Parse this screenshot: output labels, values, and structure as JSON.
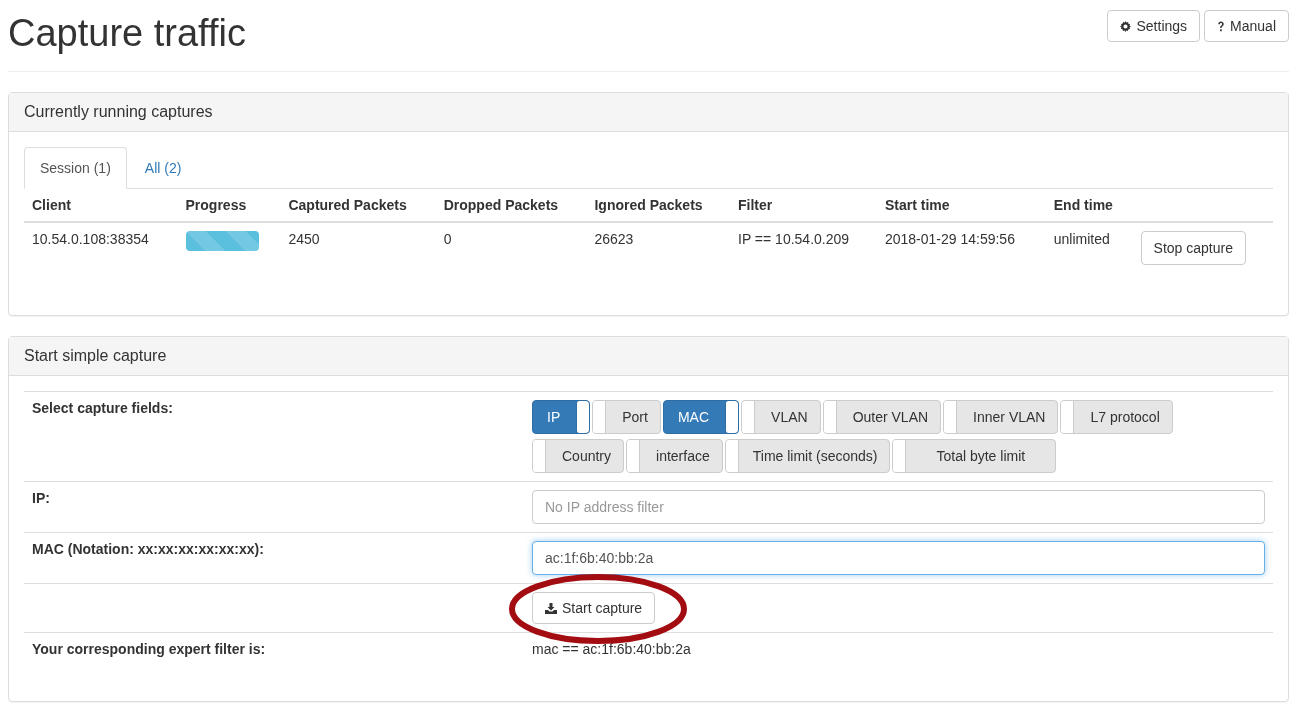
{
  "page": {
    "title": "Capture traffic",
    "buttons": [
      {
        "kind": "settings",
        "label": "Settings"
      },
      {
        "kind": "manual",
        "label": "Manual"
      }
    ]
  },
  "running_captures": {
    "heading": "Currently running captures",
    "tabs": [
      {
        "label": "Session (1)",
        "selected": true
      },
      {
        "label": "All (2)",
        "selected": false
      }
    ],
    "columns": [
      "Client",
      "Progress",
      "Captured Packets",
      "Dropped Packets",
      "Ignored Packets",
      "Filter",
      "Start time",
      "End time"
    ],
    "rows": [
      {
        "client": "10.54.0.108:38354",
        "level": 1,
        "captured": "2450",
        "dropped": "0",
        "ignored": "26623",
        "filter": "IP == 10.54.0.209",
        "start": "2018-01-29 14:59:56",
        "end": "unlimited",
        "action": "Stop capture"
      }
    ]
  },
  "simple_capture": {
    "heading": "Start simple capture",
    "fields_label": "Select capture fields:",
    "fields": [
      {
        "label": "IP",
        "on": true
      },
      {
        "label": "Port",
        "on": false
      },
      {
        "label": "MAC",
        "on": true
      },
      {
        "label": "VLAN",
        "on": false
      },
      {
        "label": "Outer VLAN",
        "on": false
      },
      {
        "label": "Inner VLAN",
        "on": false
      },
      {
        "label": "L7 protocol",
        "on": false
      },
      {
        "label": "Country",
        "on": false
      },
      {
        "label": "interface",
        "on": false
      },
      {
        "label": "Time limit (seconds)",
        "on": false
      },
      {
        "label": "Total byte limit",
        "on": false
      }
    ],
    "inputs": [
      {
        "label": "IP:",
        "placeholder": "No IP address filter",
        "focused": false
      },
      {
        "label": "MAC (Notation: xx:xx:xx:xx:xx:xx):",
        "value": "ac:1f:6b:40:bb:2a",
        "focused": true
      }
    ],
    "start_button": {
      "label": "Start capture",
      "circled": true
    },
    "expert_label": "Your corresponding expert filter is:",
    "expert_filter": "mac == ac:1f:6b:40:bb:2a"
  }
}
